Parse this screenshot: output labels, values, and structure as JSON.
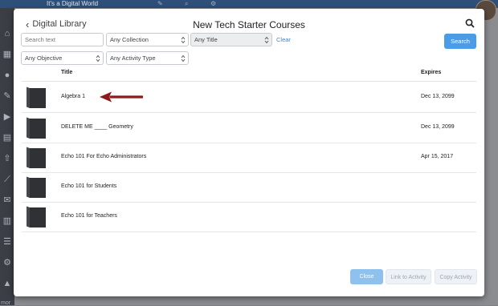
{
  "app": {
    "brand": "It's a Digital World",
    "more_label": "mor"
  },
  "modal": {
    "back_label": "Digital Library",
    "title": "New Tech Starter Courses",
    "filters": {
      "search_placeholder": "Search text",
      "collection": "Any Collection",
      "title_filter": "Any Title",
      "objective": "Any Objective",
      "activity_type": "Any Activity Type",
      "clear_label": "Clear",
      "search_button": "Search"
    },
    "table": {
      "headers": {
        "title": "Title",
        "expires": "Expires"
      },
      "rows": [
        {
          "title": "Algebra 1",
          "expires": "Dec 13, 2099"
        },
        {
          "title": "DELETE ME ____ Geometry",
          "expires": "Dec 13, 2099"
        },
        {
          "title": "Echo 101 For Echo Administrators",
          "expires": "Apr 15, 2017"
        },
        {
          "title": "Echo 101 for Students",
          "expires": ""
        },
        {
          "title": "Echo 101 for Teachers",
          "expires": ""
        }
      ]
    },
    "footer": {
      "close": "Close",
      "link_to_activity": "Link to Activity",
      "copy_activity": "Copy Activity"
    }
  },
  "colors": {
    "primary": "#4b9be6",
    "primary_light": "#8fc1ee",
    "link": "#3a86d9",
    "annotation_arrow": "#8b1a1a",
    "book_icon": "#2f3134"
  }
}
